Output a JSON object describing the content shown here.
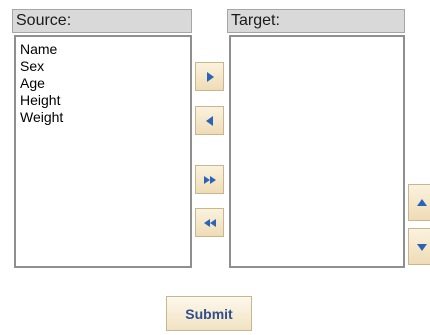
{
  "source": {
    "header": "Source:",
    "items": [
      "Name",
      "Sex",
      "Age",
      "Height",
      "Weight"
    ]
  },
  "target": {
    "header": "Target:",
    "items": []
  },
  "buttons": {
    "submit_label": "Submit"
  },
  "icons": {
    "move_right": "arrow-right-icon",
    "move_left": "arrow-left-icon",
    "move_all_right": "double-arrow-right-icon",
    "move_all_left": "double-arrow-left-icon",
    "move_up": "arrow-up-icon",
    "move_down": "arrow-down-icon"
  },
  "colors": {
    "header_bg": "#d9d9d9",
    "button_bg": "#f5e6c8",
    "arrow": "#2b63b8",
    "submit_text": "#2f4f8f"
  }
}
